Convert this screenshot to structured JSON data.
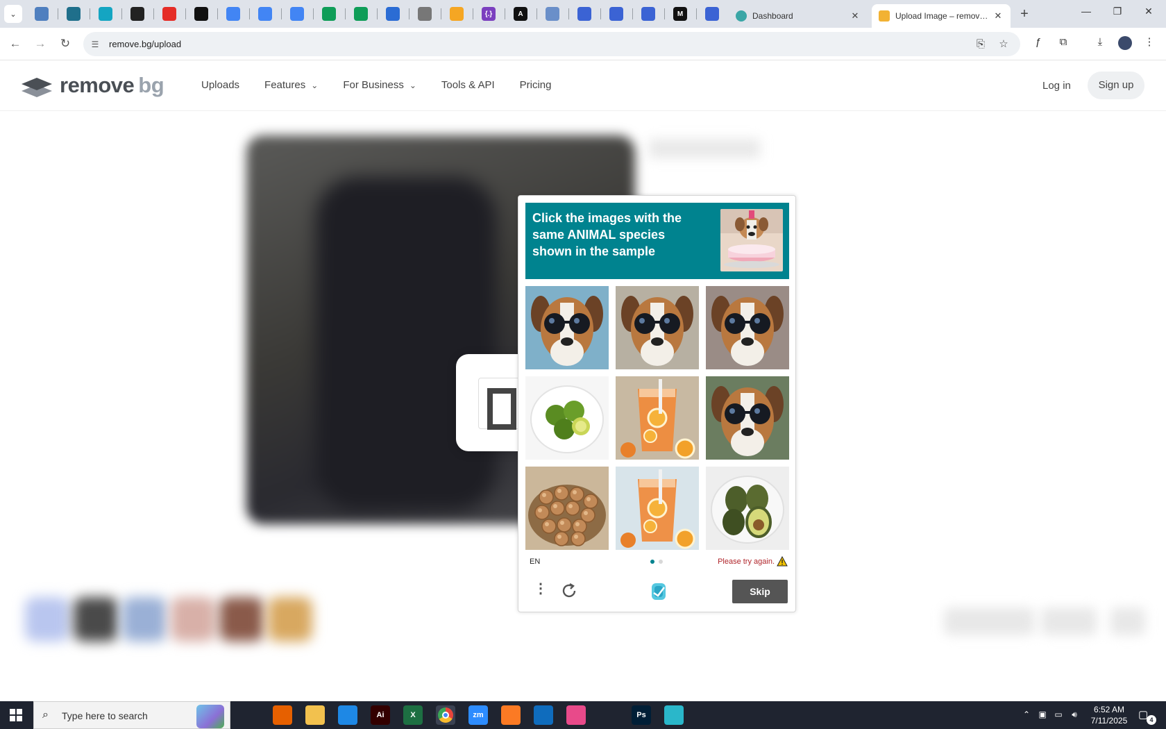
{
  "browser": {
    "pinned_tabs": [
      {
        "icon": "globe-half-icon",
        "color": "#4f7fbf",
        "label": ""
      },
      {
        "icon": "vpn-shield-icon",
        "color": "#1f6f8b",
        "label": ""
      },
      {
        "icon": "teal-arrow-icon",
        "color": "#14a5c2",
        "label": ""
      },
      {
        "icon": "openai-icon",
        "color": "#222222",
        "label": ""
      },
      {
        "icon": "youtube-icon",
        "color": "#e52d27",
        "label": ""
      },
      {
        "icon": "bolt-icon",
        "color": "#111111",
        "label": ""
      },
      {
        "icon": "google-docs-icon",
        "color": "#4285f4",
        "label": ""
      },
      {
        "icon": "google-docs-icon",
        "color": "#4285f4",
        "label": ""
      },
      {
        "icon": "google-docs-icon",
        "color": "#4285f4",
        "label": ""
      },
      {
        "icon": "google-sheets-icon",
        "color": "#0f9d58",
        "label": ""
      },
      {
        "icon": "google-sheets-icon",
        "color": "#0f9d58",
        "label": ""
      },
      {
        "icon": "ms-blue-icon",
        "color": "#2b6cd4",
        "label": ""
      },
      {
        "icon": "globe-icon",
        "color": "#777777",
        "label": ""
      },
      {
        "icon": "v-shape-icon",
        "color": "#f5a623",
        "label": ""
      },
      {
        "icon": "braces-icon",
        "color": "#7b3fbf",
        "label": "{.}"
      },
      {
        "icon": "anthropic-icon",
        "color": "#111111",
        "label": "A"
      },
      {
        "icon": "grid-blue-icon",
        "color": "#6a8fc9",
        "label": ""
      },
      {
        "icon": "forms-icon",
        "color": "#3b63d4",
        "label": ""
      },
      {
        "icon": "forms-icon",
        "color": "#3b63d4",
        "label": ""
      },
      {
        "icon": "forms-icon",
        "color": "#3b63d4",
        "label": ""
      },
      {
        "icon": "medium-icon",
        "color": "#111111",
        "label": "M"
      },
      {
        "icon": "forms-icon",
        "color": "#3b63d4",
        "label": ""
      }
    ],
    "tabs": [
      {
        "title": "Dashboard",
        "favicon_color": "#3aa6a6",
        "active": false
      },
      {
        "title": "Upload Image – remove.bg",
        "favicon_color": "#f2b233",
        "active": true
      }
    ],
    "url": "remove.bg/upload"
  },
  "site": {
    "logo_remove": "remove",
    "logo_bg": "bg",
    "nav": [
      "Uploads",
      "Features",
      "For Business",
      "Tools & API",
      "Pricing"
    ],
    "login": "Log in",
    "signup": "Sign up"
  },
  "captcha": {
    "prompt": "Click the images with the same ANIMAL species shown in the sample",
    "sample": "dog-with-cake",
    "grid": [
      {
        "subject": "dog-with-sunglasses",
        "bg": "#7fb0c9"
      },
      {
        "subject": "dog-with-sunglasses",
        "bg": "#b7b0a2"
      },
      {
        "subject": "dog-with-sunglasses",
        "bg": "#9a8c86"
      },
      {
        "subject": "limes-on-plate",
        "bg": "#f6f6f6"
      },
      {
        "subject": "iced-tea",
        "bg": "#c8b9a2"
      },
      {
        "subject": "dog-with-sunglasses",
        "bg": "#6b7d60"
      },
      {
        "subject": "hazelnuts-in-bowl",
        "bg": "#cbb79a"
      },
      {
        "subject": "iced-tea",
        "bg": "#d8e4ea"
      },
      {
        "subject": "avocados-on-plate",
        "bg": "#eeeeee"
      }
    ],
    "language": "EN",
    "error": "Please try again.",
    "skip": "Skip",
    "accent": "#00838f",
    "error_color": "#b0242a"
  },
  "taskbar": {
    "search_placeholder": "Type here to search",
    "apps": [
      {
        "icon": "task-view-icon",
        "color": "#1f2430",
        "label": ""
      },
      {
        "icon": "firefox-icon",
        "color": "#e66000",
        "label": ""
      },
      {
        "icon": "file-explorer-icon",
        "color": "#f2c14e",
        "label": ""
      },
      {
        "icon": "vscode-icon",
        "color": "#1e88e5",
        "label": ""
      },
      {
        "icon": "illustrator-icon",
        "color": "#330000",
        "label": "Ai"
      },
      {
        "icon": "excel-icon",
        "color": "#1d6f42",
        "label": "X"
      },
      {
        "icon": "chrome-icon",
        "color": "#e8453c",
        "label": ""
      },
      {
        "icon": "zoom-icon",
        "color": "#2d8cff",
        "label": "zm"
      },
      {
        "icon": "xampp-icon",
        "color": "#fb7a24",
        "label": ""
      },
      {
        "icon": "outlook-icon",
        "color": "#0f6cbd",
        "label": ""
      },
      {
        "icon": "paint-icon",
        "color": "#e84a8a",
        "label": ""
      },
      {
        "icon": "pen-icon",
        "color": "#1f2430",
        "label": ""
      },
      {
        "icon": "photoshop-icon",
        "color": "#001e36",
        "label": "Ps"
      },
      {
        "icon": "sketch-icon",
        "color": "#2ab7ca",
        "label": ""
      },
      {
        "icon": "snipping-tool-icon",
        "color": "#1f2430",
        "label": ""
      }
    ],
    "time": "6:52 AM",
    "date": "7/11/2025",
    "notifications": "4"
  }
}
